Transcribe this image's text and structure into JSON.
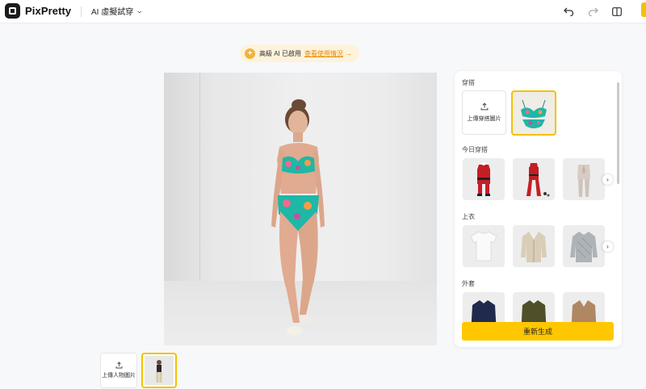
{
  "app": {
    "name": "PixPretty",
    "tool_label": "AI 虛擬試穿"
  },
  "toolbar": {
    "undo_icon": "undo-icon",
    "redo_icon": "redo-icon",
    "compare_icon": "split-view-icon"
  },
  "banner": {
    "text": "高級 AI 已啟用",
    "link": "查看使用情況",
    "arrow": "→"
  },
  "person": {
    "upload_label": "上傳人物圖片"
  },
  "panel": {
    "outfit_label": "穿搭",
    "upload_outfit_label": "上傳穿搭圖片",
    "sections": [
      {
        "label": "今日穿搭",
        "items": [
          "santa-costume",
          "red-santa-outfit",
          "beige-suit"
        ]
      },
      {
        "label": "上衣",
        "items": [
          "white-tshirt",
          "beige-cardigan",
          "grey-quilted-jacket"
        ]
      },
      {
        "label": "外套",
        "items": [
          "navy-jacket",
          "olive-jacket",
          "camel-coat"
        ]
      }
    ],
    "regenerate_label": "重新生成"
  },
  "colors": {
    "accent": "#ffc700",
    "selected_border": "#f2c200",
    "link": "#e68a00"
  }
}
